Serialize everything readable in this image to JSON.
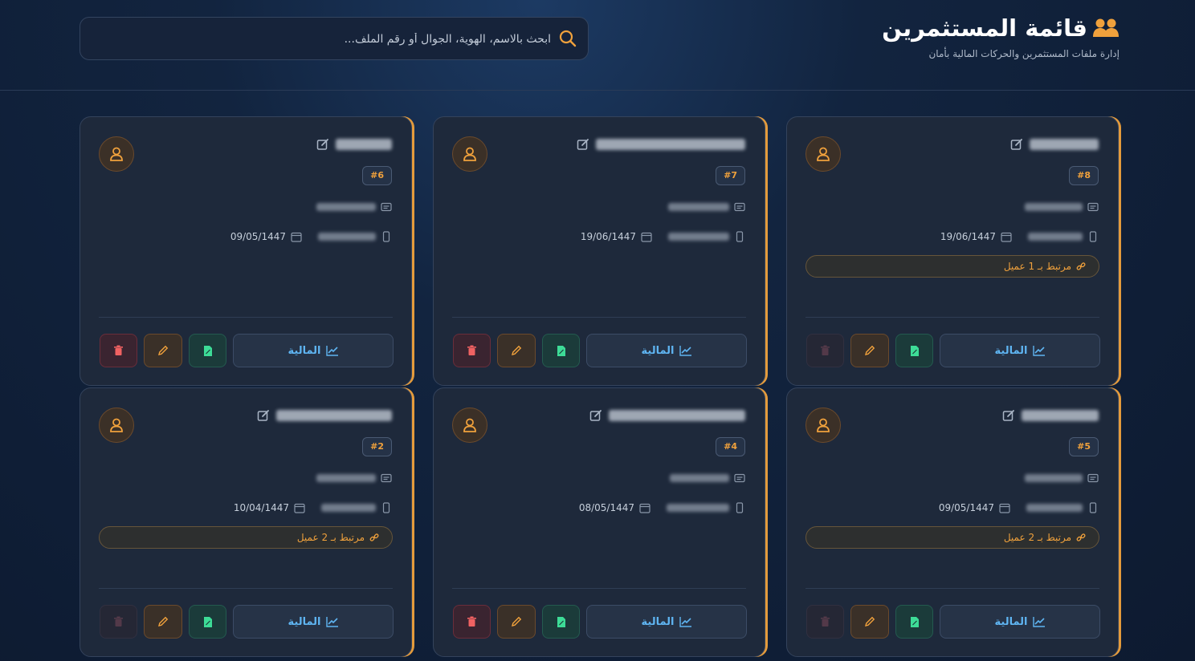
{
  "header": {
    "title": "قائمة المستثمرين",
    "subtitle": "إدارة ملفات المستثمرين والحركات المالية بأمان",
    "search_placeholder": "ابحث بالاسم، الهوية، الجوال أو رقم الملف...",
    "search_value": ""
  },
  "colors": {
    "accent": "#f0a13c",
    "finance": "#5fb5f2",
    "pdf": "#3ddc97",
    "delete": "#f06262"
  },
  "cards": [
    {
      "id": "#8",
      "date": "19/06/1447",
      "linked": "مرتبط بـ 1 عميل",
      "finance_label": "المالية"
    },
    {
      "id": "#7",
      "date": "19/06/1447",
      "linked": "",
      "finance_label": "المالية"
    },
    {
      "id": "#6",
      "date": "09/05/1447",
      "linked": "",
      "finance_label": "المالية"
    },
    {
      "id": "#5",
      "date": "09/05/1447",
      "linked": "مرتبط بـ 2 عميل",
      "finance_label": "المالية"
    },
    {
      "id": "#4",
      "date": "08/05/1447",
      "linked": "",
      "finance_label": "المالية"
    },
    {
      "id": "#2",
      "date": "10/04/1447",
      "linked": "مرتبط بـ 2 عميل",
      "finance_label": "المالية"
    }
  ]
}
